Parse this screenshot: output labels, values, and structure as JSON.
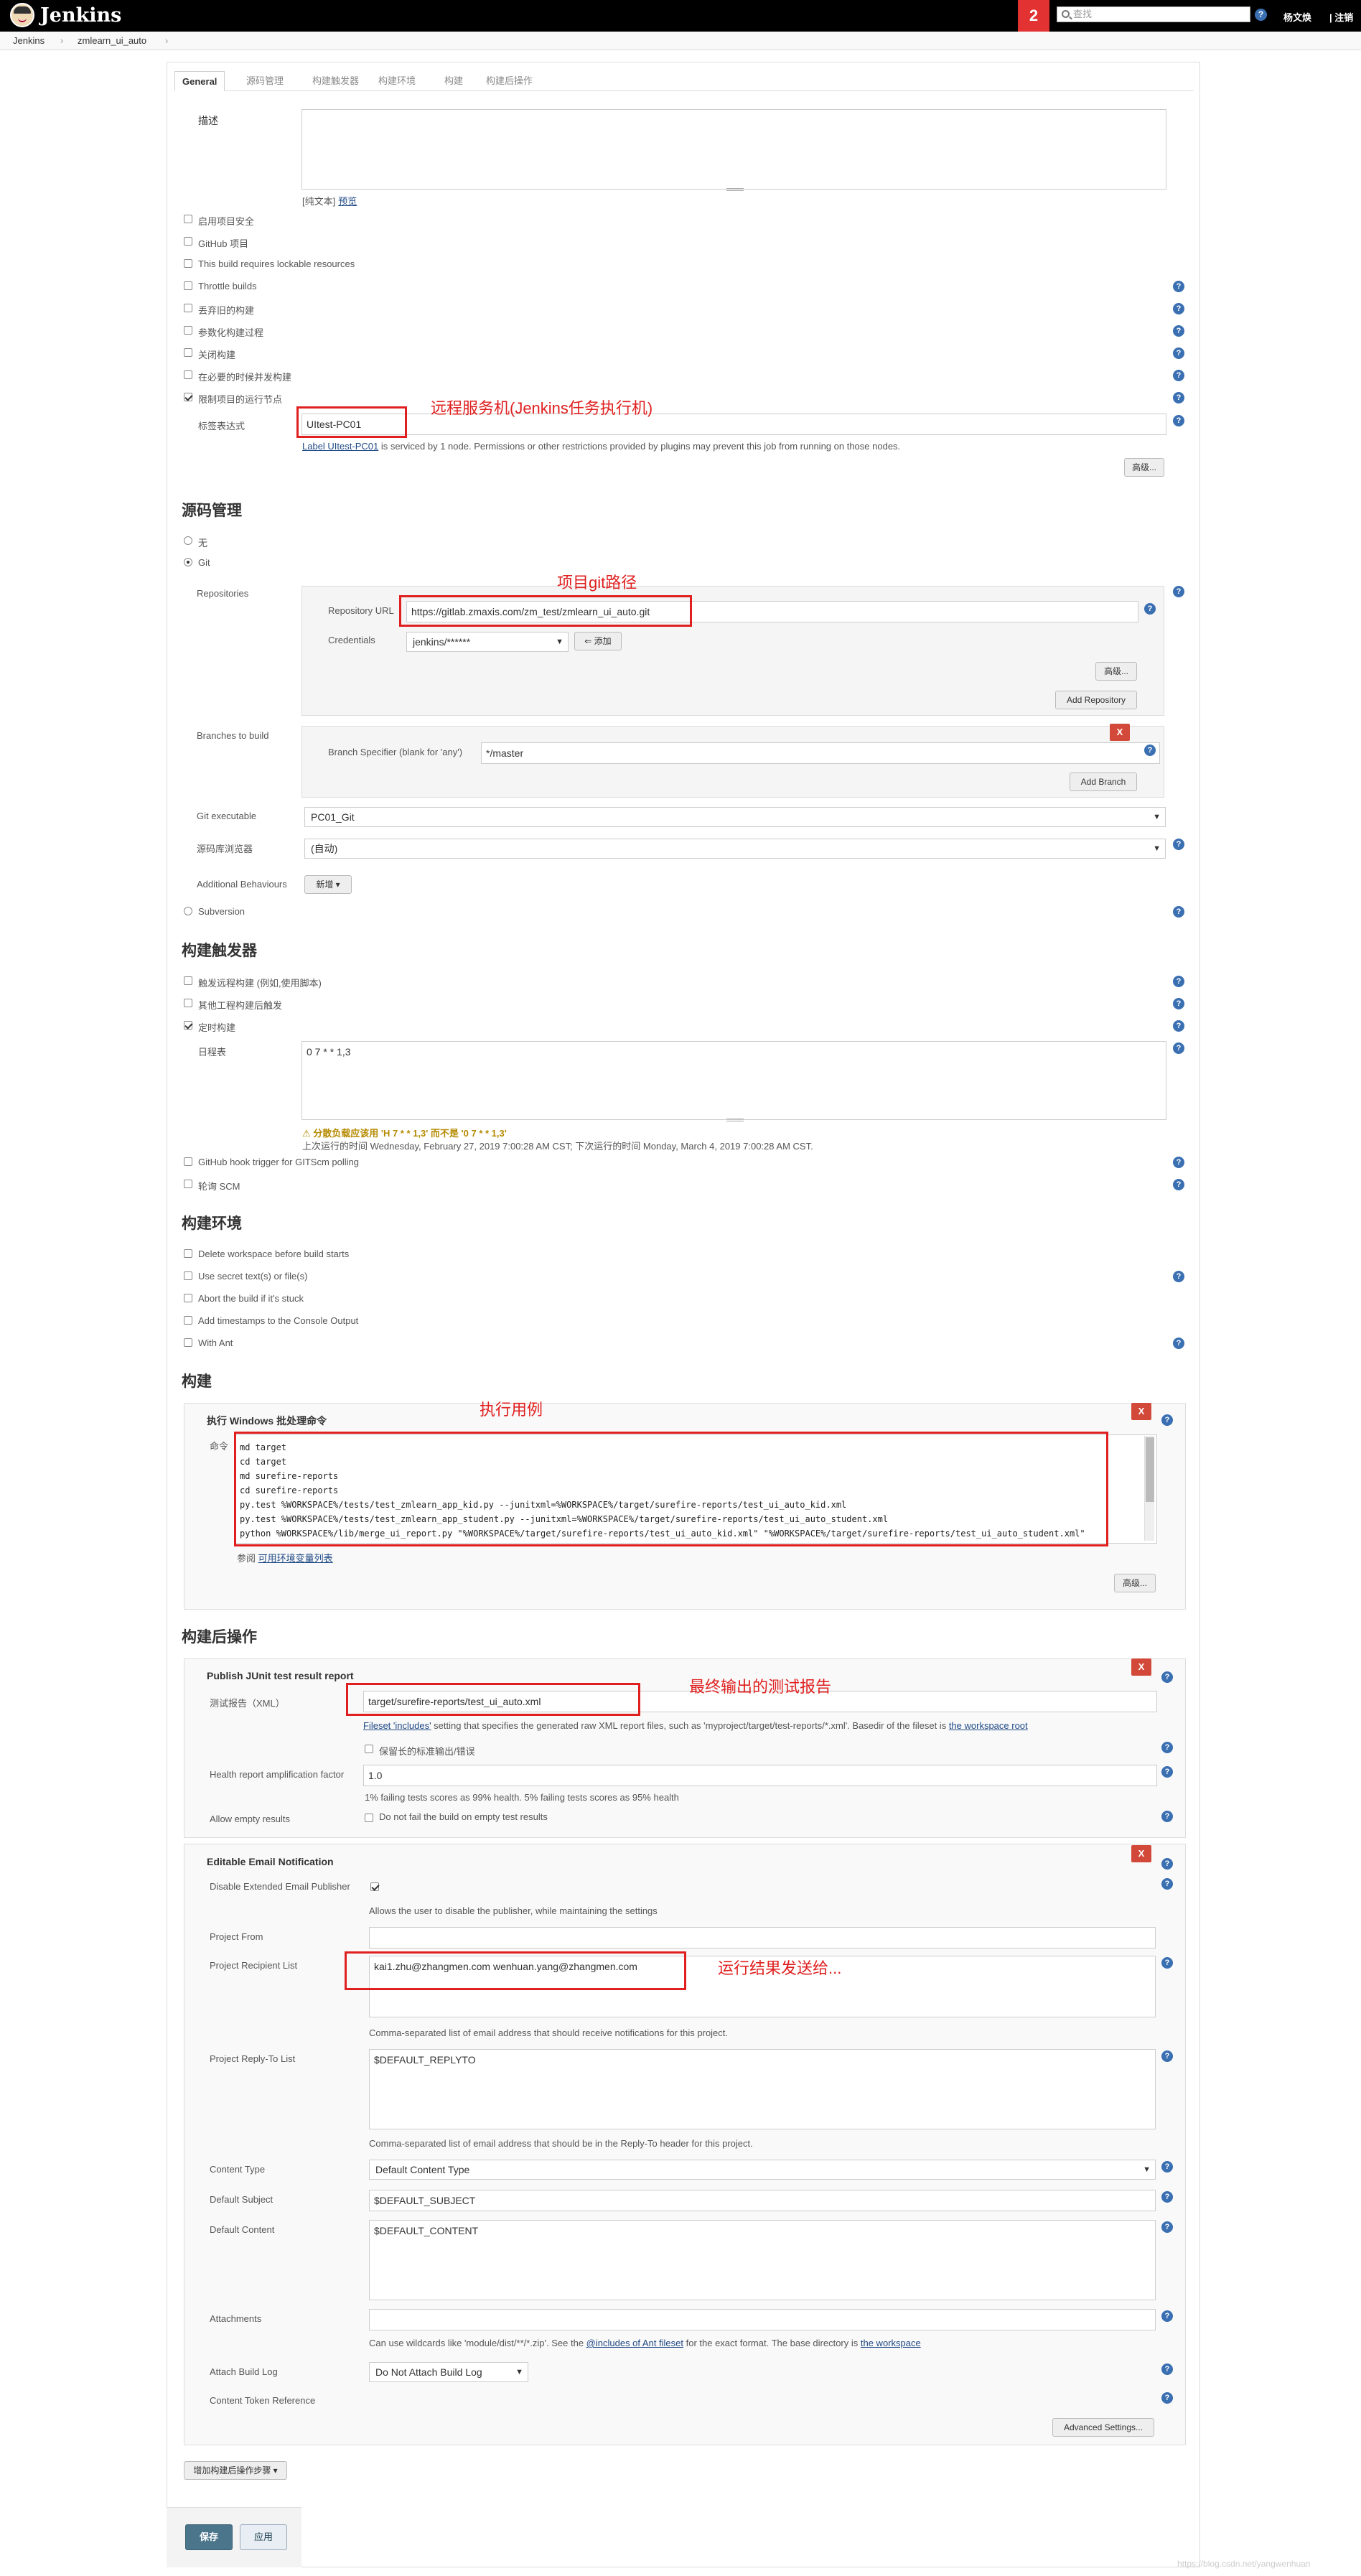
{
  "header": {
    "app_name": "Jenkins",
    "notification_count": "2",
    "search_placeholder": "查找",
    "help": "?",
    "user": "杨文焕",
    "logout": "| 注销"
  },
  "breadcrumb": [
    "Jenkins",
    "›",
    "zmlearn_ui_auto",
    "›"
  ],
  "tabs": [
    "General",
    "源码管理",
    "构建触发器",
    "构建环境",
    "构建",
    "构建后操作"
  ],
  "general": {
    "description_label": "描述",
    "plain_text": "[纯文本]",
    "preview": "预览",
    "options": [
      "启用项目安全",
      "GitHub 项目",
      "This build requires lockable resources",
      "Throttle builds",
      "丢弃旧的构建",
      "参数化构建过程",
      "关闭构建",
      "在必要的时候并发构建",
      "限制项目的运行节点"
    ],
    "label_expr_label": "标签表达式",
    "label_expr_value": "UItest-PC01",
    "label_link": "Label UItest-PC01",
    "label_desc": " is serviced by 1 node. Permissions or other restrictions provided by plugins may prevent this job from running on those nodes.",
    "advanced": "高级..."
  },
  "scm": {
    "title": "源码管理",
    "none": "无",
    "git": "Git",
    "repositories": "Repositories",
    "repo_url_label": "Repository URL",
    "repo_url": "https://gitlab.zmaxis.com/zm_test/zmlearn_ui_auto.git",
    "credentials_label": "Credentials",
    "credentials": "jenkins/******",
    "add": "⇐ 添加",
    "advanced": "高级...",
    "add_repo": "Add Repository",
    "branches_label": "Branches to build",
    "branch_spec_label": "Branch Specifier (blank for 'any')",
    "branch_spec": "*/master",
    "add_branch": "Add Branch",
    "x": "X",
    "git_exe_label": "Git executable",
    "git_exe": "PC01_Git",
    "browser_label": "源码库浏览器",
    "browser": "(自动)",
    "behaviours_label": "Additional Behaviours",
    "behaviours_btn": "新增 ▾",
    "subversion": "Subversion"
  },
  "triggers": {
    "title": "构建触发器",
    "options": [
      "触发远程构建 (例如,使用脚本)",
      "其他工程构建后触发",
      "定时构建"
    ],
    "schedule_label": "日程表",
    "schedule": "0 7 * * 1,3",
    "warning": "⚠ 分散负载应该用 'H 7 * * 1,3' 而不是 '0 7 * * 1,3'",
    "next_run": "上次运行的时间 Wednesday, February 27, 2019 7:00:28 AM CST; 下次运行的时间 Monday, March 4, 2019 7:00:28 AM CST.",
    "options2": [
      "GitHub hook trigger for GITScm polling",
      "轮询 SCM"
    ]
  },
  "env": {
    "title": "构建环境",
    "options": [
      "Delete workspace before build starts",
      "Use secret text(s) or file(s)",
      "Abort the build if it's stuck",
      "Add timestamps to the Console Output",
      "With Ant"
    ]
  },
  "build": {
    "title": "构建",
    "step_title": "执行 Windows 批处理命令",
    "command_label": "命令",
    "commands": [
      "md target",
      "cd target",
      "md surefire-reports",
      "cd surefire-reports",
      "py.test %WORKSPACE%/tests/test_zmlearn_app_kid.py --junitxml=%WORKSPACE%/target/surefire-reports/test_ui_auto_kid.xml",
      "py.test %WORKSPACE%/tests/test_zmlearn_app_student.py --junitxml=%WORKSPACE%/target/surefire-reports/test_ui_auto_student.xml",
      "python %WORKSPACE%/lib/merge_ui_report.py \"%WORKSPACE%/target/surefire-reports/test_ui_auto_kid.xml\" \"%WORKSPACE%/target/surefire-reports/test_ui_auto_student.xml\""
    ],
    "see": "参阅 ",
    "env_link": "可用环境变量列表",
    "advanced": "高级..."
  },
  "post": {
    "title": "构建后操作",
    "junit_title": "Publish JUnit test result report",
    "report_label": "测试报告（XML）",
    "report_value": "target/surefire-reports/test_ui_auto.xml",
    "fileset_link": "Fileset 'includes'",
    "fileset_desc": " setting that specifies the generated raw XML report files, such as 'myproject/target/test-reports/*.xml'. Basedir of the fileset is ",
    "workspace_root": "the workspace root",
    "keep_stdio": "保留长的标准输出/错误",
    "health_label": "Health report amplification factor",
    "health_value": "1.0",
    "health_desc": "1% failing tests scores as 99% health. 5% failing tests scores as 95% health",
    "allow_empty_label": "Allow empty results",
    "allow_empty_desc": "Do not fail the build on empty test results",
    "email_title": "Editable Email Notification",
    "disable_label": "Disable Extended Email Publisher",
    "disable_desc": "Allows the user to disable the publisher, while maintaining the settings",
    "project_from": "Project From",
    "recipient_label": "Project Recipient List",
    "recipient_value": "kai1.zhu@zhangmen.com wenhuan.yang@zhangmen.com",
    "recipient_desc": "Comma-separated list of email address that should receive notifications for this project.",
    "replyto_label": "Project Reply-To List",
    "replyto_value": "$DEFAULT_REPLYTO",
    "replyto_desc": "Comma-separated list of email address that should be in the Reply-To header for this project.",
    "content_type_label": "Content Type",
    "content_type": "Default Content Type",
    "subject_label": "Default Subject",
    "subject": "$DEFAULT_SUBJECT",
    "content_label": "Default Content",
    "content": "$DEFAULT_CONTENT",
    "attachments_label": "Attachments",
    "attach_desc1": "Can use wildcards like 'module/dist/**/*.zip'. See the ",
    "attach_link1": "@includes of Ant fileset",
    "attach_desc2": " for the exact format. The base directory is ",
    "attach_link2": "the workspace",
    "attach_log_label": "Attach Build Log",
    "attach_log": "Do Not Attach Build Log",
    "token_label": "Content Token Reference",
    "advanced_settings": "Advanced Settings...",
    "add_step": "增加构建后操作步骤 ▾"
  },
  "footer": {
    "save": "保存",
    "apply": "应用"
  },
  "annotations": {
    "remote": "远程服务机(Jenkins任务执行机)",
    "git_path": "项目git路径",
    "run_cases": "执行用例",
    "final_report": "最终输出的测试报告",
    "send_to": "运行结果发送给..."
  },
  "watermark": "https://blog.csdn.net/yangwenhuan"
}
